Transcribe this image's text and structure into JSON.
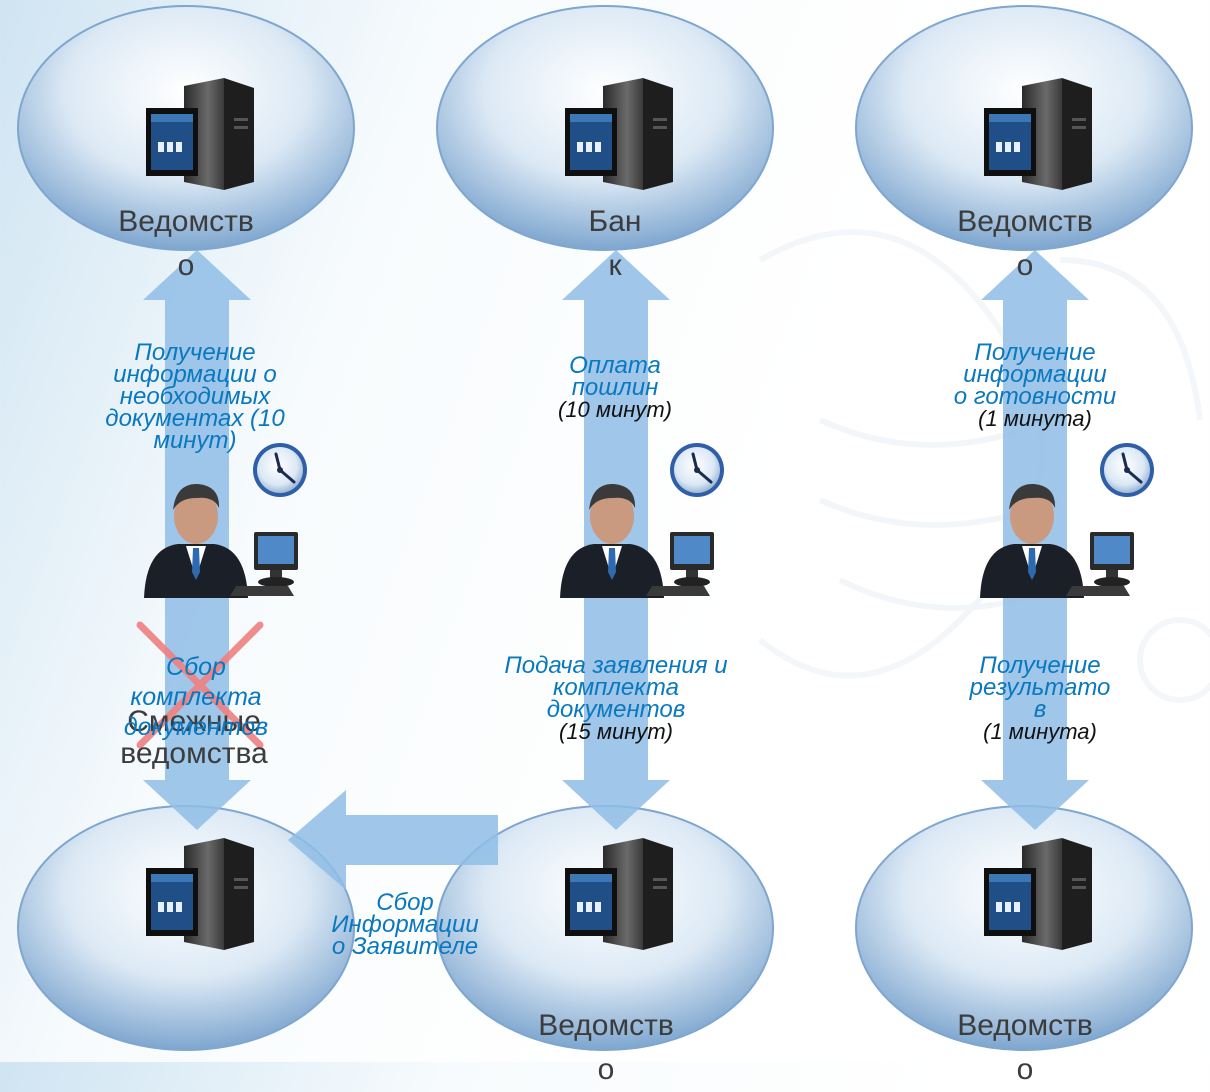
{
  "nodes": {
    "top_left": "Ведомство",
    "top_mid": "Банк",
    "top_right": "Ведомство",
    "bottom_left_l1": "Смежные",
    "bottom_left_l2": "ведомства",
    "bottom_mid": "Ведомство",
    "bottom_right": "Ведомство"
  },
  "labels": {
    "left_up": [
      "Получение",
      "информации о",
      "необходимых",
      "документах (10",
      "минут)"
    ],
    "mid_up": [
      "Оплата",
      "пошлин"
    ],
    "mid_up_time": "(10 минут)",
    "right_up": [
      "Получение",
      "информации",
      "о готовности"
    ],
    "right_up_time": "(1 минута)",
    "left_down": [
      "Сбор",
      "комплекта",
      "документов"
    ],
    "mid_down": [
      "Подача заявления и",
      "комплекта",
      "документов"
    ],
    "mid_down_time": "(15 минут)",
    "right_down": [
      "Получение",
      "результато",
      "в"
    ],
    "right_down_time": "(1 минута)",
    "collect_info": [
      "Сбор",
      "Информации",
      "о Заявителе"
    ]
  },
  "colors": {
    "accent_text": "#0a78bf",
    "arrow": "#8fbde6",
    "ellipse": "#a9c9e6",
    "cross": "#f08080"
  }
}
